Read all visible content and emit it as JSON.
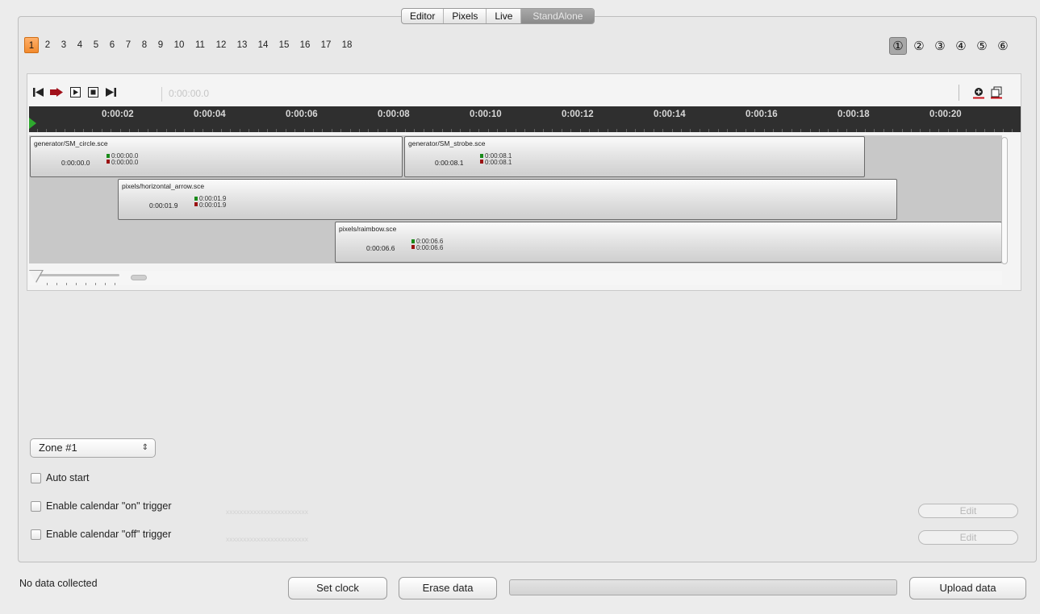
{
  "mode_tabs": [
    "Editor",
    "Pixels",
    "Live",
    "StandAlone"
  ],
  "active_mode": "StandAlone",
  "pages": [
    "1",
    "2",
    "3",
    "4",
    "5",
    "6",
    "7",
    "8",
    "9",
    "10",
    "11",
    "12",
    "13",
    "14",
    "15",
    "16",
    "17",
    "18"
  ],
  "active_page": "1",
  "zone_buttons": [
    "①",
    "②",
    "③",
    "④",
    "⑤",
    "⑥"
  ],
  "active_zone_button": "①",
  "transport": {
    "time": "0:00:00.0",
    "icons": [
      "skip-to-start-icon",
      "record-play-icon",
      "play-icon",
      "stop-icon",
      "skip-to-end-icon"
    ]
  },
  "ruler_labels": [
    "0:00:02",
    "0:00:04",
    "0:00:06",
    "0:00:08",
    "0:00:10",
    "0:00:12",
    "0:00:14",
    "0:00:16",
    "0:00:18",
    "0:00:20"
  ],
  "tracks": [
    {
      "clips": [
        {
          "name": "generator/SM_circle.sce",
          "start": "0:00:00.0",
          "in": "0:00:00.0",
          "out": "0:00:00.0"
        },
        {
          "name": "generator/SM_strobe.sce",
          "start": "0:00:08.1",
          "in": "0:00:08.1",
          "out": "0:00:08.1"
        }
      ]
    },
    {
      "clips": [
        {
          "name": "pixels/horizontal_arrow.sce",
          "start": "0:00:01.9",
          "in": "0:00:01.9",
          "out": "0:00:01.9"
        }
      ]
    },
    {
      "clips": [
        {
          "name": "pixels/raimbow.sce",
          "start": "0:00:06.6",
          "in": "0:00:06.6",
          "out": "0:00:06.6"
        }
      ]
    }
  ],
  "zone_select": {
    "value": "Zone #1",
    "arrows": "⇕"
  },
  "options": {
    "auto_start": "Auto start",
    "calendar_on": "Enable calendar \"on\" trigger",
    "calendar_off": "Enable calendar \"off\" trigger",
    "calendar_placeholder": "xxxxxxxxxxxxxxxxxxxxxxxx",
    "edit": "Edit"
  },
  "status": "No data collected",
  "buttons": {
    "set_clock": "Set clock",
    "erase_data": "Erase data",
    "upload_data": "Upload data"
  },
  "upload_progress": 0,
  "colors": {
    "accent_page": "#f28a2e",
    "ruler_bg": "#2f2f2f",
    "playhead": "#2ea82e",
    "mark_in": "#1a8a1a",
    "mark_out": "#9a1212"
  }
}
